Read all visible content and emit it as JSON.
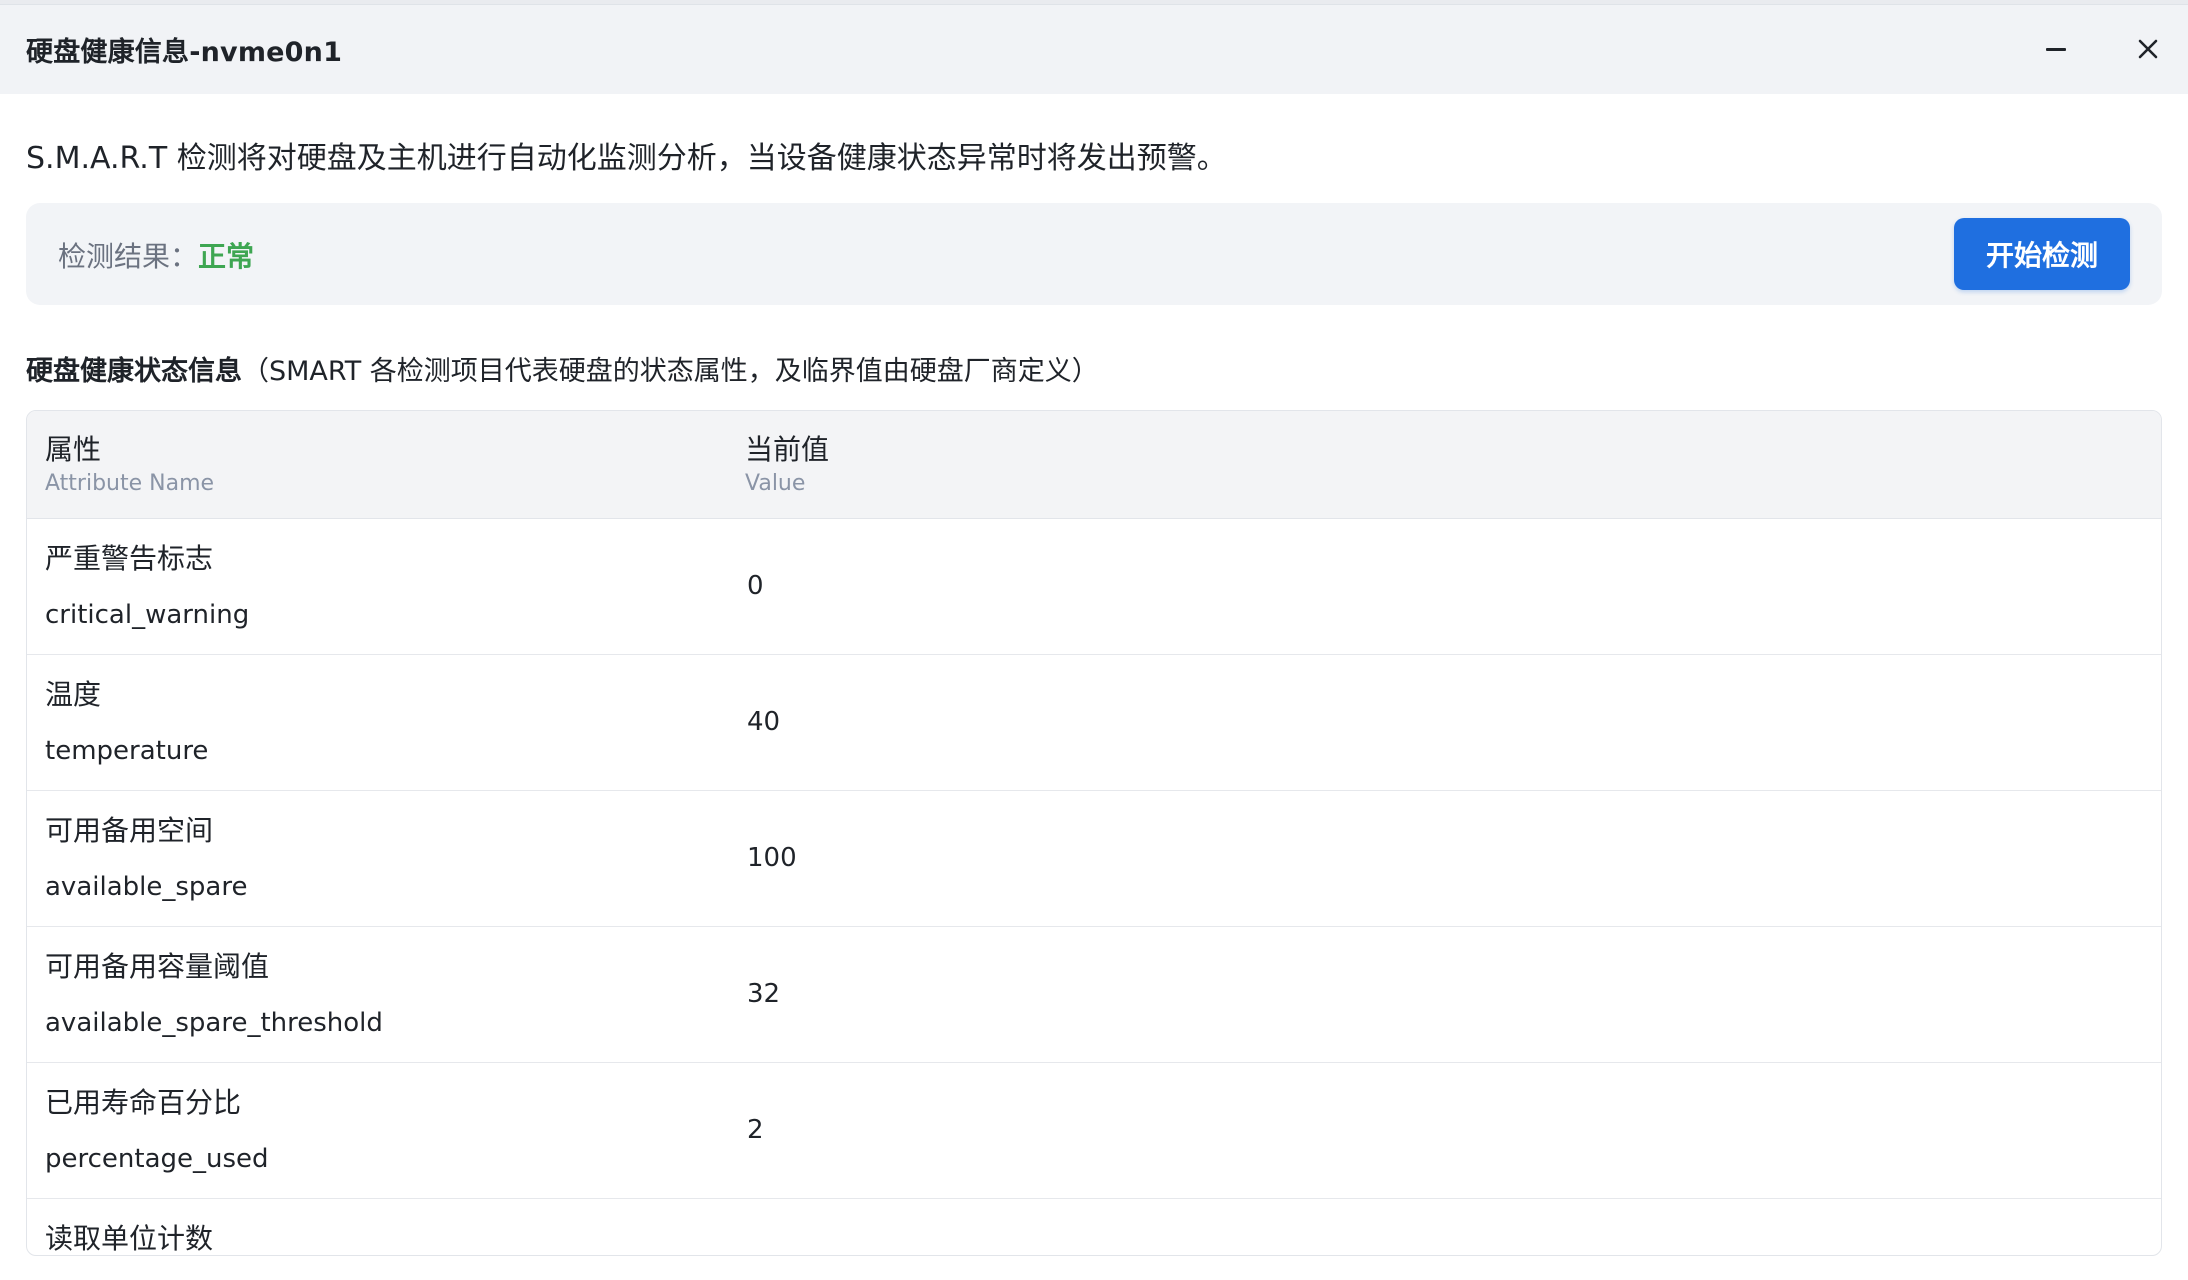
{
  "modal": {
    "title": "硬盘健康信息-nvme0n1",
    "intro": "S.M.A.R.T 检测将对硬盘及主机进行自动化监测分析，当设备健康状态异常时将发出预警。"
  },
  "result": {
    "label": "检测结果：",
    "value": "正常",
    "status_color": "#3ea652",
    "start_button_label": "开始检测"
  },
  "section": {
    "heading": "硬盘健康状态信息",
    "note": "（SMART 各检测项目代表硬盘的状态属性，及临界值由硬盘厂商定义）"
  },
  "table": {
    "columns": [
      {
        "zh": "属性",
        "en": "Attribute Name"
      },
      {
        "zh": "当前值",
        "en": "Value"
      }
    ],
    "rows": [
      {
        "zh": "严重警告标志",
        "en": "critical_warning",
        "value": "0"
      },
      {
        "zh": "温度",
        "en": "temperature",
        "value": "40"
      },
      {
        "zh": "可用备用空间",
        "en": "available_spare",
        "value": "100"
      },
      {
        "zh": "可用备用容量阈值",
        "en": "available_spare_threshold",
        "value": "32"
      },
      {
        "zh": "已用寿命百分比",
        "en": "percentage_used",
        "value": "2"
      },
      {
        "zh": "读取单位计数",
        "en": "",
        "value": ""
      }
    ]
  },
  "colors": {
    "accent": "#1f6fe0",
    "titlebar_bg": "#f1f3f6"
  },
  "icons": {
    "minimize": "minimize-icon",
    "close": "close-icon"
  }
}
